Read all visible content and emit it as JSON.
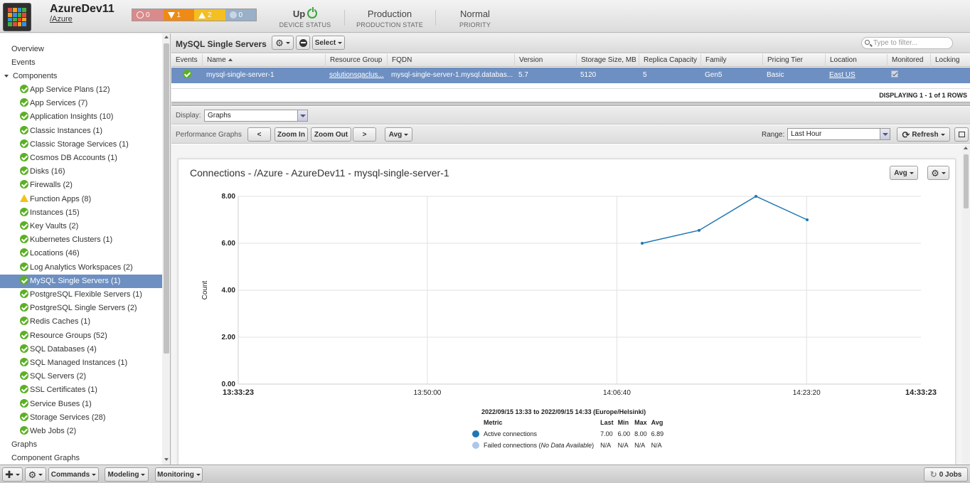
{
  "header": {
    "device_name": "AzureDev11",
    "device_path": "/Azure",
    "events": [
      {
        "count": "0",
        "color": "#d98b8b",
        "icon": "critical-icon"
      },
      {
        "count": "1",
        "color": "#f08a14",
        "icon": "error-icon"
      },
      {
        "count": "2",
        "color": "#f3bf22",
        "icon": "warning-icon"
      },
      {
        "count": "0",
        "color": "#9ab0c8",
        "icon": "info-icon"
      }
    ],
    "device_status": {
      "value": "Up",
      "label": "DEVICE STATUS"
    },
    "production_state": {
      "value": "Production",
      "label": "PRODUCTION STATE"
    },
    "priority": {
      "value": "Normal",
      "label": "PRIORITY"
    }
  },
  "sidebar": {
    "top_items": [
      "Overview",
      "Events"
    ],
    "components_label": "Components",
    "components": [
      {
        "label": "App Service Plans (12)",
        "status": "ok"
      },
      {
        "label": "App Services (7)",
        "status": "ok"
      },
      {
        "label": "Application Insights (10)",
        "status": "ok"
      },
      {
        "label": "Classic Instances (1)",
        "status": "ok"
      },
      {
        "label": "Classic Storage Services (1)",
        "status": "ok"
      },
      {
        "label": "Cosmos DB Accounts (1)",
        "status": "ok"
      },
      {
        "label": "Disks (16)",
        "status": "ok"
      },
      {
        "label": "Firewalls (2)",
        "status": "ok"
      },
      {
        "label": "Function Apps (8)",
        "status": "warning"
      },
      {
        "label": "Instances (15)",
        "status": "ok"
      },
      {
        "label": "Key Vaults (2)",
        "status": "ok"
      },
      {
        "label": "Kubernetes Clusters (1)",
        "status": "ok"
      },
      {
        "label": "Locations (46)",
        "status": "ok"
      },
      {
        "label": "Log Analytics Workspaces (2)",
        "status": "ok"
      },
      {
        "label": "MySQL Single Servers (1)",
        "status": "ok",
        "selected": true
      },
      {
        "label": "PostgreSQL Flexible Servers (1)",
        "status": "ok"
      },
      {
        "label": "PostgreSQL Single Servers (2)",
        "status": "ok"
      },
      {
        "label": "Redis Caches (1)",
        "status": "ok"
      },
      {
        "label": "Resource Groups (52)",
        "status": "ok"
      },
      {
        "label": "SQL Databases (4)",
        "status": "ok"
      },
      {
        "label": "SQL Managed Instances (1)",
        "status": "ok"
      },
      {
        "label": "SQL Servers (2)",
        "status": "ok"
      },
      {
        "label": "SSL Certificates (1)",
        "status": "ok"
      },
      {
        "label": "Service Buses (1)",
        "status": "ok"
      },
      {
        "label": "Storage Services (28)",
        "status": "ok"
      },
      {
        "label": "Web Jobs (2)",
        "status": "ok"
      }
    ],
    "bottom_items": [
      "Graphs",
      "Component Graphs"
    ]
  },
  "grid": {
    "title": "MySQL Single Servers",
    "select_label": "Select",
    "filter_placeholder": "Type to filter...",
    "columns": [
      "Events",
      "Name",
      "Resource Group",
      "FQDN",
      "Version",
      "Storage Size, MB",
      "Replica Capacity",
      "Family",
      "Pricing Tier",
      "Location",
      "Monitored",
      "Locking"
    ],
    "row": {
      "name": "mysql-single-server-1",
      "resource_group": "solutionsqaclus...",
      "fqdn": "mysql-single-server-1.mysql.databas...",
      "version": "5.7",
      "storage": "5120",
      "replica": "5",
      "family": "Gen5",
      "pricing": "Basic",
      "location": "East US"
    },
    "displaying": "DISPLAYING 1 - 1 of 1 ROWS"
  },
  "graphs": {
    "display_label": "Display:",
    "display_value": "Graphs",
    "perf_label": "Performance Graphs",
    "prev_label": "<",
    "zoom_in": "Zoom In",
    "zoom_out": "Zoom Out",
    "next_label": ">",
    "agg_label": "Avg",
    "range_label": "Range:",
    "range_value": "Last Hour",
    "refresh_label": "Refresh"
  },
  "chart_data": {
    "type": "line",
    "title": "Connections - /Azure - AzureDev11 - mysql-single-server-1",
    "ylabel": "Count",
    "xlabel": "",
    "ylim": [
      0,
      8
    ],
    "y_ticks": [
      "0.00",
      "2.00",
      "4.00",
      "6.00",
      "8.00"
    ],
    "x_ticks": [
      "13:33:23",
      "13:50:00",
      "14:06:40",
      "14:23:20",
      "14:33:23"
    ],
    "x_tick_minutes": [
      0,
      16.62,
      33.28,
      49.95,
      60
    ],
    "series": [
      {
        "name": "Active connections",
        "color": "#1f77b4",
        "x_minutes": [
          35.5,
          40.5,
          45.5,
          50.0
        ],
        "values": [
          6,
          6.55,
          8,
          7
        ]
      },
      {
        "name": "Failed connections",
        "color": "#aec7e8",
        "x_minutes": [],
        "values": []
      }
    ],
    "grid": true,
    "legend": {
      "range_text": "2022/09/15 13:33 to 2022/09/15 14:33 (Europe/Helsinki)",
      "headers": [
        "Metric",
        "Last",
        "Min",
        "Max",
        "Avg"
      ],
      "rows": [
        {
          "metric": "Active connections",
          "note": "",
          "last": "7.00",
          "min": "6.00",
          "max": "8.00",
          "avg": "6.89"
        },
        {
          "metric": "Failed connections",
          "note": "No Data Available",
          "last": "N/A",
          "min": "N/A",
          "max": "N/A",
          "avg": "N/A"
        }
      ]
    }
  },
  "footer": {
    "commands": "Commands",
    "modeling": "Modeling",
    "monitoring": "Monitoring",
    "jobs": "0 Jobs"
  }
}
